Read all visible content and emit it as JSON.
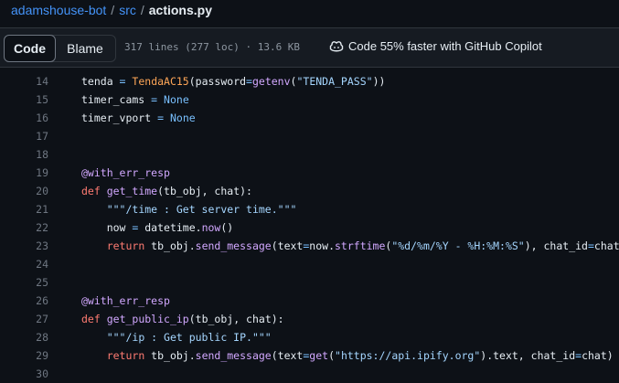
{
  "breadcrumb": {
    "repo": "adamshouse-bot",
    "folder": "src",
    "sep": "/",
    "file": "actions.py"
  },
  "toolbar": {
    "code_label": "Code",
    "blame_label": "Blame",
    "file_meta": "317 lines (277 loc) · 13.6 KB",
    "copilot_label": "Code 55% faster with GitHub Copilot",
    "copilot_icon": "copilot-icon"
  },
  "code": {
    "lines": [
      {
        "num": "14",
        "tokens": [
          [
            "",
            "tenda "
          ],
          [
            "op",
            "="
          ],
          [
            "",
            " "
          ],
          [
            "cls",
            "TendaAC15"
          ],
          [
            "",
            "(password"
          ],
          [
            "op",
            "="
          ],
          [
            "fn",
            "getenv"
          ],
          [
            "",
            "("
          ],
          [
            "str",
            "\"TENDA_PASS\""
          ],
          [
            "",
            "))"
          ]
        ]
      },
      {
        "num": "15",
        "tokens": [
          [
            "",
            "timer_cams "
          ],
          [
            "op",
            "="
          ],
          [
            "",
            " "
          ],
          [
            "const",
            "None"
          ]
        ]
      },
      {
        "num": "16",
        "tokens": [
          [
            "",
            "timer_vport "
          ],
          [
            "op",
            "="
          ],
          [
            "",
            " "
          ],
          [
            "const",
            "None"
          ]
        ]
      },
      {
        "num": "17",
        "tokens": []
      },
      {
        "num": "18",
        "tokens": []
      },
      {
        "num": "19",
        "tokens": [
          [
            "deco",
            "@with_err_resp"
          ]
        ]
      },
      {
        "num": "20",
        "tokens": [
          [
            "kw",
            "def"
          ],
          [
            "",
            " "
          ],
          [
            "fn",
            "get_time"
          ],
          [
            "",
            "(tb_obj, chat):"
          ]
        ]
      },
      {
        "num": "21",
        "tokens": [
          [
            "",
            "    "
          ],
          [
            "str",
            "\"\"\"/time : Get server time.\"\"\""
          ]
        ]
      },
      {
        "num": "22",
        "tokens": [
          [
            "",
            "    now "
          ],
          [
            "op",
            "="
          ],
          [
            "",
            " datetime."
          ],
          [
            "fn",
            "now"
          ],
          [
            "",
            "()"
          ]
        ]
      },
      {
        "num": "23",
        "tokens": [
          [
            "",
            "    "
          ],
          [
            "kw",
            "return"
          ],
          [
            "",
            " tb_obj."
          ],
          [
            "fn",
            "send_message"
          ],
          [
            "",
            "(text"
          ],
          [
            "op",
            "="
          ],
          [
            "",
            "now."
          ],
          [
            "fn",
            "strftime"
          ],
          [
            "",
            "("
          ],
          [
            "str",
            "\"%d/%m/%Y - %H:%M:%S\""
          ],
          [
            "",
            "), chat_id"
          ],
          [
            "op",
            "="
          ],
          [
            "",
            "chat)"
          ]
        ]
      },
      {
        "num": "24",
        "tokens": []
      },
      {
        "num": "25",
        "tokens": []
      },
      {
        "num": "26",
        "tokens": [
          [
            "deco",
            "@with_err_resp"
          ]
        ]
      },
      {
        "num": "27",
        "tokens": [
          [
            "kw",
            "def"
          ],
          [
            "",
            " "
          ],
          [
            "fn",
            "get_public_ip"
          ],
          [
            "",
            "(tb_obj, chat):"
          ]
        ]
      },
      {
        "num": "28",
        "tokens": [
          [
            "",
            "    "
          ],
          [
            "str",
            "\"\"\"/ip : Get public IP.\"\"\""
          ]
        ]
      },
      {
        "num": "29",
        "tokens": [
          [
            "",
            "    "
          ],
          [
            "kw",
            "return"
          ],
          [
            "",
            " tb_obj."
          ],
          [
            "fn",
            "send_message"
          ],
          [
            "",
            "(text"
          ],
          [
            "op",
            "="
          ],
          [
            "fn",
            "get"
          ],
          [
            "",
            "("
          ],
          [
            "str",
            "\"https://api.ipify.org\""
          ],
          [
            "",
            ").text, chat_id"
          ],
          [
            "op",
            "="
          ],
          [
            "",
            "chat)"
          ]
        ]
      },
      {
        "num": "30",
        "tokens": []
      }
    ]
  }
}
